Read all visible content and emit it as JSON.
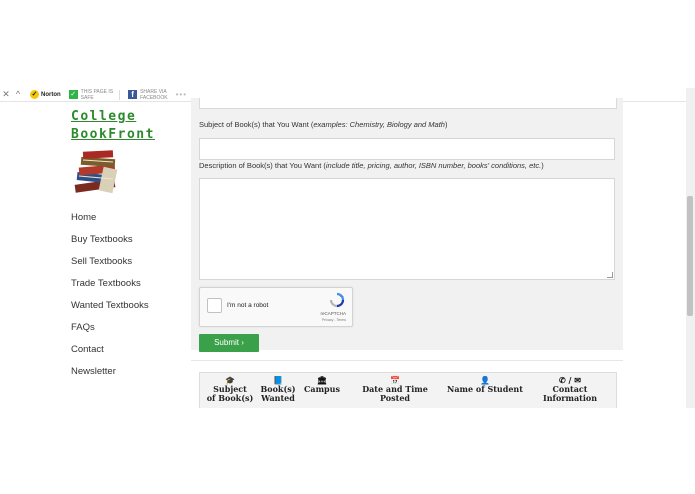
{
  "toolbar": {
    "close_glyph": "✕",
    "collapse_glyph": "^",
    "norton_label": "Norton",
    "safe_line1": "THIS PAGE IS",
    "safe_line2": "SAFE",
    "share_line1": "SHARE VIA",
    "share_line2": "FACEBOOK",
    "more": "•••"
  },
  "site": {
    "title_line1": "College",
    "title_line2": "BookFront"
  },
  "nav": {
    "items": [
      "Home",
      "Buy Textbooks",
      "Sell Textbooks",
      "Trade Textbooks",
      "Wanted Textbooks",
      "FAQs",
      "Contact",
      "Newsletter"
    ]
  },
  "form": {
    "subject_label": "Subject of Book(s) that You Want (",
    "subject_hint": "examples: Chemistry, Biology and Math",
    "subject_close": ")",
    "desc_label": "Description of Book(s) that You Want (",
    "desc_hint": "include title, pricing, author, ISBN number, books' conditions, etc.",
    "desc_close": ")",
    "captcha_text": "I'm not a robot",
    "captcha_brand": "reCAPTCHA",
    "captcha_terms": "Privacy - Terms",
    "submit_label": "Submit ›"
  },
  "table": {
    "headers": [
      {
        "icon": "graduation-cap-icon",
        "glyph": "🎓",
        "line1": "Subject",
        "line2": "of Book(s)"
      },
      {
        "icon": "book-icon",
        "glyph": "📘",
        "line1": "Book(s)",
        "line2": "Wanted"
      },
      {
        "icon": "bank-icon",
        "glyph": "🏛",
        "line1": "Campus",
        "line2": ""
      },
      {
        "icon": "calendar-icon",
        "glyph": "📅",
        "line1": "Date and Time Posted",
        "line2": ""
      },
      {
        "icon": "user-icon",
        "glyph": "👤",
        "line1": "Name of Student",
        "line2": ""
      },
      {
        "icon": "phone-envelope-icon",
        "glyph": "✆ / ✉",
        "line1": "Contact",
        "line2": "Information"
      }
    ]
  },
  "colors": {
    "accent": "#3aa04a",
    "title": "#2c8a2c",
    "panel": "#f1f1f1"
  }
}
